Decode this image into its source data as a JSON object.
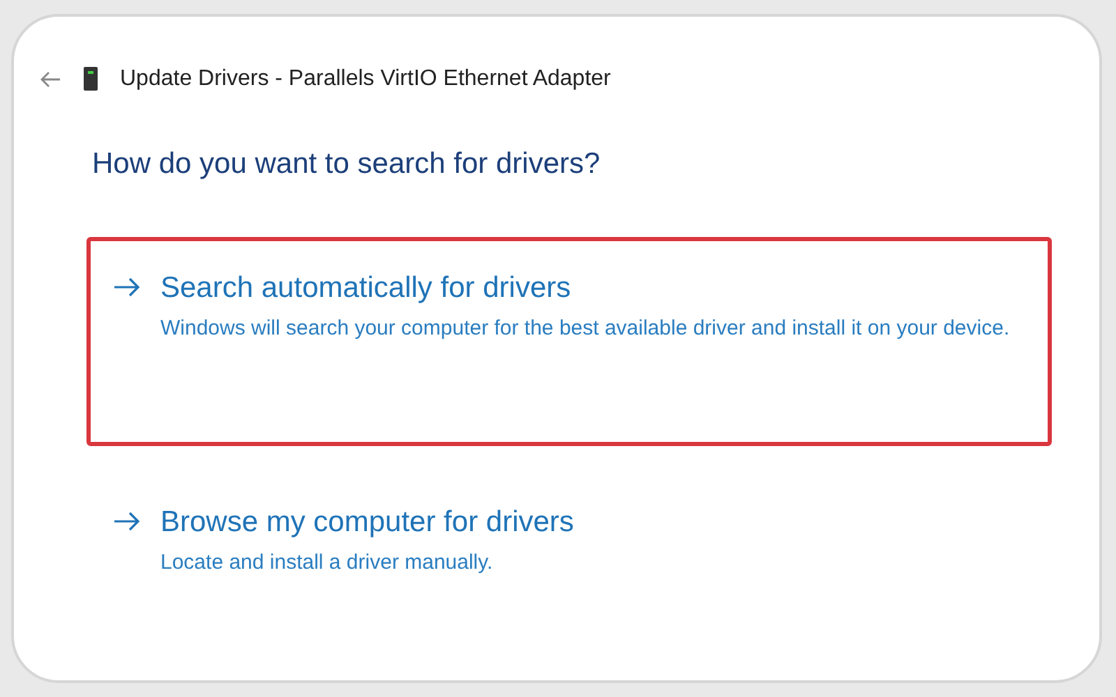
{
  "window": {
    "title": "Update Drivers - Parallels VirtIO Ethernet Adapter"
  },
  "heading": "How do you want to search for drivers?",
  "options": [
    {
      "title": "Search automatically for drivers",
      "description": "Windows will search your computer for the best available driver and install it on your device.",
      "highlighted": true
    },
    {
      "title": "Browse my computer for drivers",
      "description": "Locate and install a driver manually.",
      "highlighted": false
    }
  ]
}
